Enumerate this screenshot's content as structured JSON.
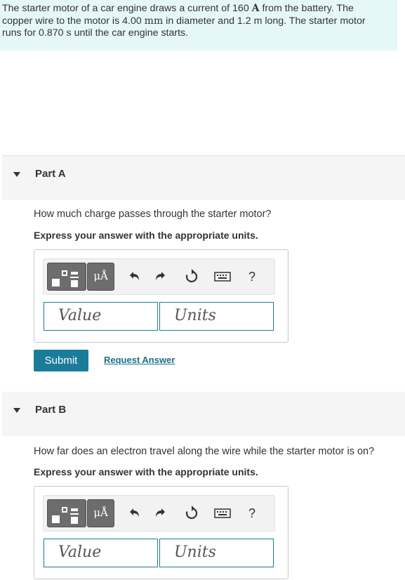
{
  "problem": {
    "line1_pre": "The starter motor of a car engine draws a current of 160 ",
    "line1_unit": "A",
    "line1_post": " from the battery. The",
    "line2_pre": "copper wire to the motor is 4.00 ",
    "line2_unit": "mm",
    "line2_post": " in diameter and 1.2 m long. The starter motor",
    "line3_pre": "runs for 0.870 ",
    "line3_unit": "s",
    "line3_post": " until the car engine starts."
  },
  "parts": [
    {
      "title": "Part A",
      "question": "How much charge passes through the starter motor?",
      "instruction": "Express your answer with the appropriate units.",
      "value_placeholder": "Value",
      "units_placeholder": "Units",
      "units_tool_label": "μÅ",
      "help_label": "?",
      "submit_label": "Submit",
      "request_label": "Request Answer"
    },
    {
      "title": "Part B",
      "question": "How far does an electron travel along the wire while the starter motor is on?",
      "instruction": "Express your answer with the appropriate units.",
      "value_placeholder": "Value",
      "units_placeholder": "Units",
      "units_tool_label": "μÅ",
      "help_label": "?"
    }
  ],
  "colors": {
    "problem_bg": "#e6f7f7",
    "accent": "#1b7b9a",
    "part_header_bg": "#f5f5f5"
  }
}
